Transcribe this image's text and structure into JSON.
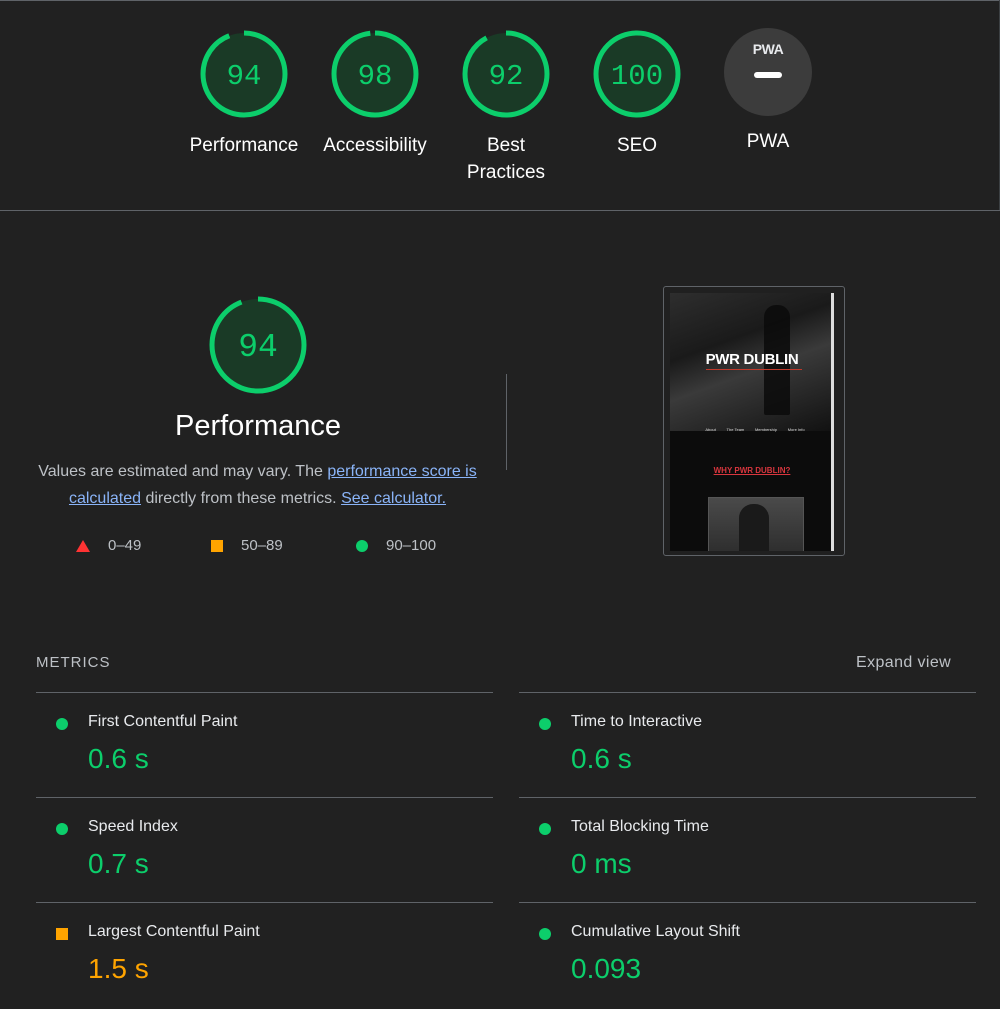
{
  "summary": {
    "gauges": [
      {
        "label": "Performance",
        "score": "94",
        "fraction": 0.94
      },
      {
        "label": "Accessibility",
        "score": "98",
        "fraction": 0.98
      },
      {
        "label": "Best Practices",
        "score": "92",
        "fraction": 0.92
      },
      {
        "label": "SEO",
        "score": "100",
        "fraction": 1.0
      },
      {
        "label": "PWA",
        "badge": "PWA"
      }
    ]
  },
  "performance": {
    "score": "94",
    "fraction": 0.94,
    "title": "Performance",
    "desc_prefix": "Values are estimated and may vary. The",
    "link_score": "performance score is calculated",
    "desc_middle": "directly from these metrics.",
    "link_calc": "See calculator.",
    "legend": [
      {
        "range": "0–49",
        "icon": "fail-triangle-icon"
      },
      {
        "range": "50–89",
        "icon": "average-square-icon"
      },
      {
        "range": "90–100",
        "icon": "pass-circle-icon"
      }
    ]
  },
  "screenshot": {
    "title": "PWR DUBLIN",
    "nav": [
      "About",
      "The Team",
      "Membership",
      "More Info"
    ],
    "heading": "WHY PWR DUBLIN?"
  },
  "metrics": {
    "header": "METRICS",
    "expand": "Expand view",
    "items": [
      {
        "title": "First Contentful Paint",
        "value": "0.6 s",
        "status": "pass"
      },
      {
        "title": "Time to Interactive",
        "value": "0.6 s",
        "status": "pass"
      },
      {
        "title": "Speed Index",
        "value": "0.7 s",
        "status": "pass"
      },
      {
        "title": "Total Blocking Time",
        "value": "0 ms",
        "status": "pass"
      },
      {
        "title": "Largest Contentful Paint",
        "value": "1.5 s",
        "status": "average"
      },
      {
        "title": "Cumulative Layout Shift",
        "value": "0.093",
        "status": "pass"
      }
    ]
  },
  "colors": {
    "pass": "#0cce6b",
    "average": "#ffa400",
    "fail": "#ff3333",
    "background": "#212121"
  }
}
